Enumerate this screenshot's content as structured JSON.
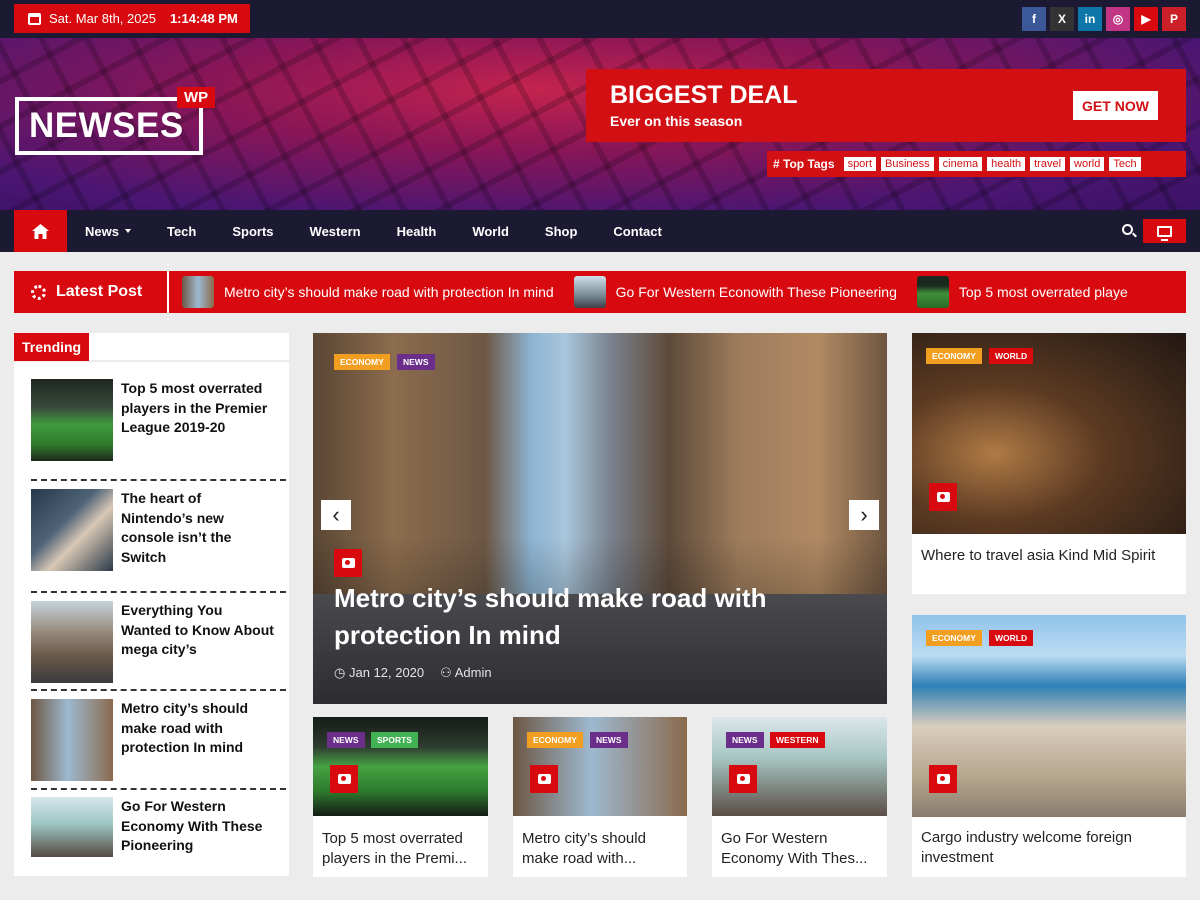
{
  "topbar": {
    "date": "Sat. Mar 8th, 2025",
    "time": "1:14:48 PM",
    "socials": [
      {
        "icon": "facebook-icon",
        "glyph": "f",
        "color": "#3b5998"
      },
      {
        "icon": "x-icon",
        "glyph": "X",
        "color": "#333333"
      },
      {
        "icon": "linkedin-icon",
        "glyph": "in",
        "color": "#0e76a8"
      },
      {
        "icon": "instagram-icon",
        "glyph": "◎",
        "color": "#c13584"
      },
      {
        "icon": "youtube-icon",
        "glyph": "▶",
        "color": "#d8090f"
      },
      {
        "icon": "pinterest-icon",
        "glyph": "P",
        "color": "#cb2027"
      }
    ]
  },
  "header": {
    "logo": "NEWSES",
    "logo_badge": "WP",
    "deal_title": "BIGGEST DEAL",
    "deal_subtitle": "Ever on this season",
    "deal_button": "GET NOW",
    "tags_label": "# Top Tags",
    "tags": [
      "sport",
      "Business",
      "cinema",
      "health",
      "travel",
      "world",
      "Tech"
    ]
  },
  "nav": {
    "items": [
      "News",
      "Tech",
      "Sports",
      "Western",
      "Health",
      "World",
      "Shop",
      "Contact"
    ]
  },
  "latest": {
    "label": "Latest Post",
    "items": [
      "Metro city’s should make road with protection In mind",
      "Go For Western Econowith These Pioneering",
      "Top 5 most overrated playe"
    ]
  },
  "trending": {
    "label": "Trending",
    "items": [
      "Top 5 most overrated players in the Premier League 2019-20",
      "The heart of Nintendo’s new console isn’t the Switch",
      "Everything You Wanted to Know About mega city’s",
      "Metro city’s should make road with protection In mind",
      "Go For Western Economy With These Pioneering"
    ]
  },
  "hero": {
    "categories": [
      "ECONOMY",
      "NEWS"
    ],
    "title": "Metro city’s should make road with protection In mind",
    "date": "Jan 12, 2020",
    "author": "Admin"
  },
  "cards": [
    {
      "categories": [
        "NEWS",
        "SPORTS"
      ],
      "title": "Top 5 most overrated players in the Premi..."
    },
    {
      "categories": [
        "ECONOMY",
        "NEWS"
      ],
      "title": "Metro city’s should make road with..."
    },
    {
      "categories": [
        "NEWS",
        "WESTERN"
      ],
      "title": "Go For Western Economy With Thes..."
    }
  ],
  "side_cards": [
    {
      "categories": [
        "ECONOMY",
        "WORLD"
      ],
      "title": "Where to travel asia Kind Mid Spirit"
    },
    {
      "categories": [
        "ECONOMY",
        "WORLD"
      ],
      "title": "Cargo industry welcome foreign investment"
    }
  ],
  "colors": {
    "accent": "#d8090f",
    "navy": "#1c1a33"
  }
}
